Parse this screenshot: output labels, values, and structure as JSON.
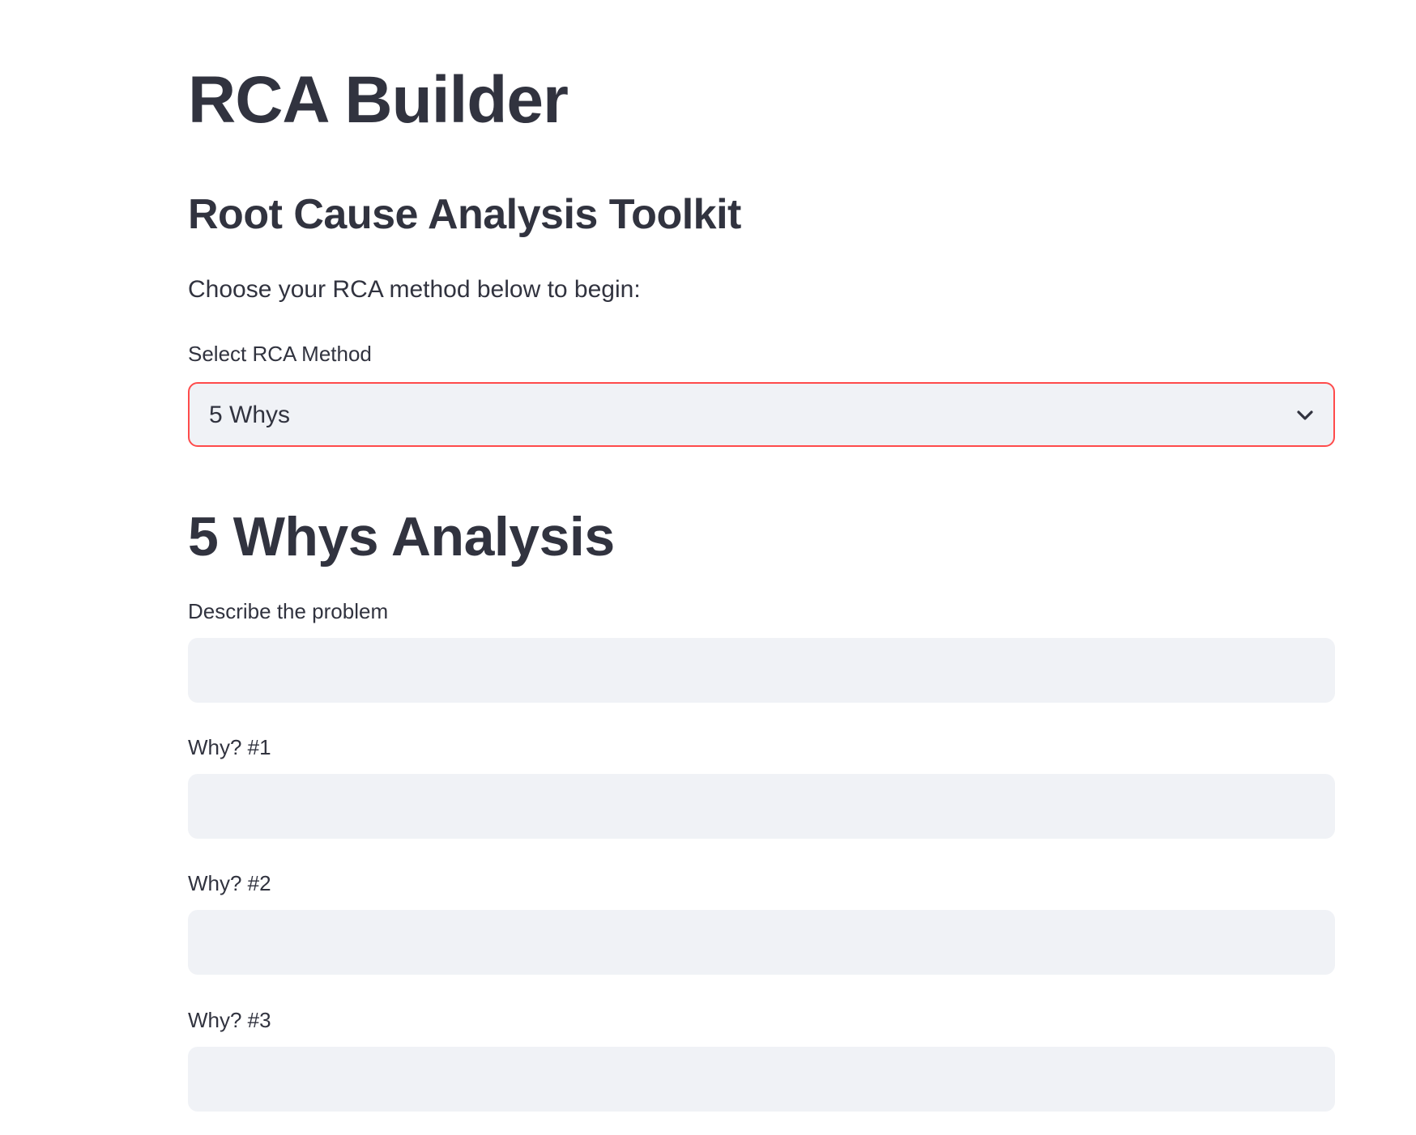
{
  "app": {
    "title": "RCA Builder",
    "subtitle": "Root Cause Analysis Toolkit",
    "intro": "Choose your RCA method below to begin:"
  },
  "method_select": {
    "label": "Select RCA Method",
    "selected_value": "5 Whys",
    "icon": "chevron-down-icon",
    "focus_border_color": "#ff4b4b"
  },
  "analysis": {
    "title": "5 Whys Analysis",
    "fields": [
      {
        "label": "Describe the problem",
        "value": "",
        "placeholder": ""
      },
      {
        "label": "Why? #1",
        "value": "",
        "placeholder": ""
      },
      {
        "label": "Why? #2",
        "value": "",
        "placeholder": ""
      },
      {
        "label": "Why? #3",
        "value": "",
        "placeholder": ""
      }
    ]
  },
  "colors": {
    "text": "#31333f",
    "input_background": "#f0f2f6",
    "page_background": "#ffffff"
  }
}
